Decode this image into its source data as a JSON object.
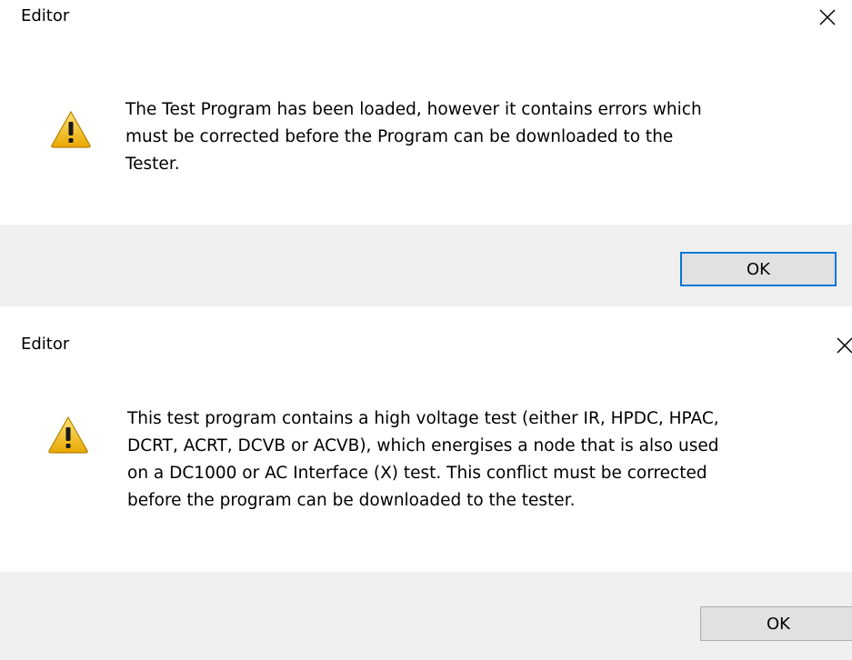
{
  "dialogs": [
    {
      "title": "Editor",
      "icon": "warning-icon",
      "message_lines": [
        "The Test Program has been loaded, however it contains errors which",
        "must be corrected before the Program can be downloaded to the",
        "Tester."
      ],
      "ok_label": "OK"
    },
    {
      "title": "Editor",
      "icon": "warning-icon",
      "message_lines": [
        "This test program contains a high voltage test (either IR, HPDC, HPAC,",
        "DCRT, ACRT, DCVB or ACVB), which energises a node that is also used",
        "on a DC1000 or AC Interface (X) test. This conflict must be corrected",
        "before the program can be downloaded to the tester."
      ],
      "ok_label": "OK"
    }
  ],
  "colors": {
    "footer_background": "#f0f0f0",
    "button_background": "#e1e1e1",
    "focus_border": "#0078d7",
    "warning_yellow": "#f4c430"
  }
}
